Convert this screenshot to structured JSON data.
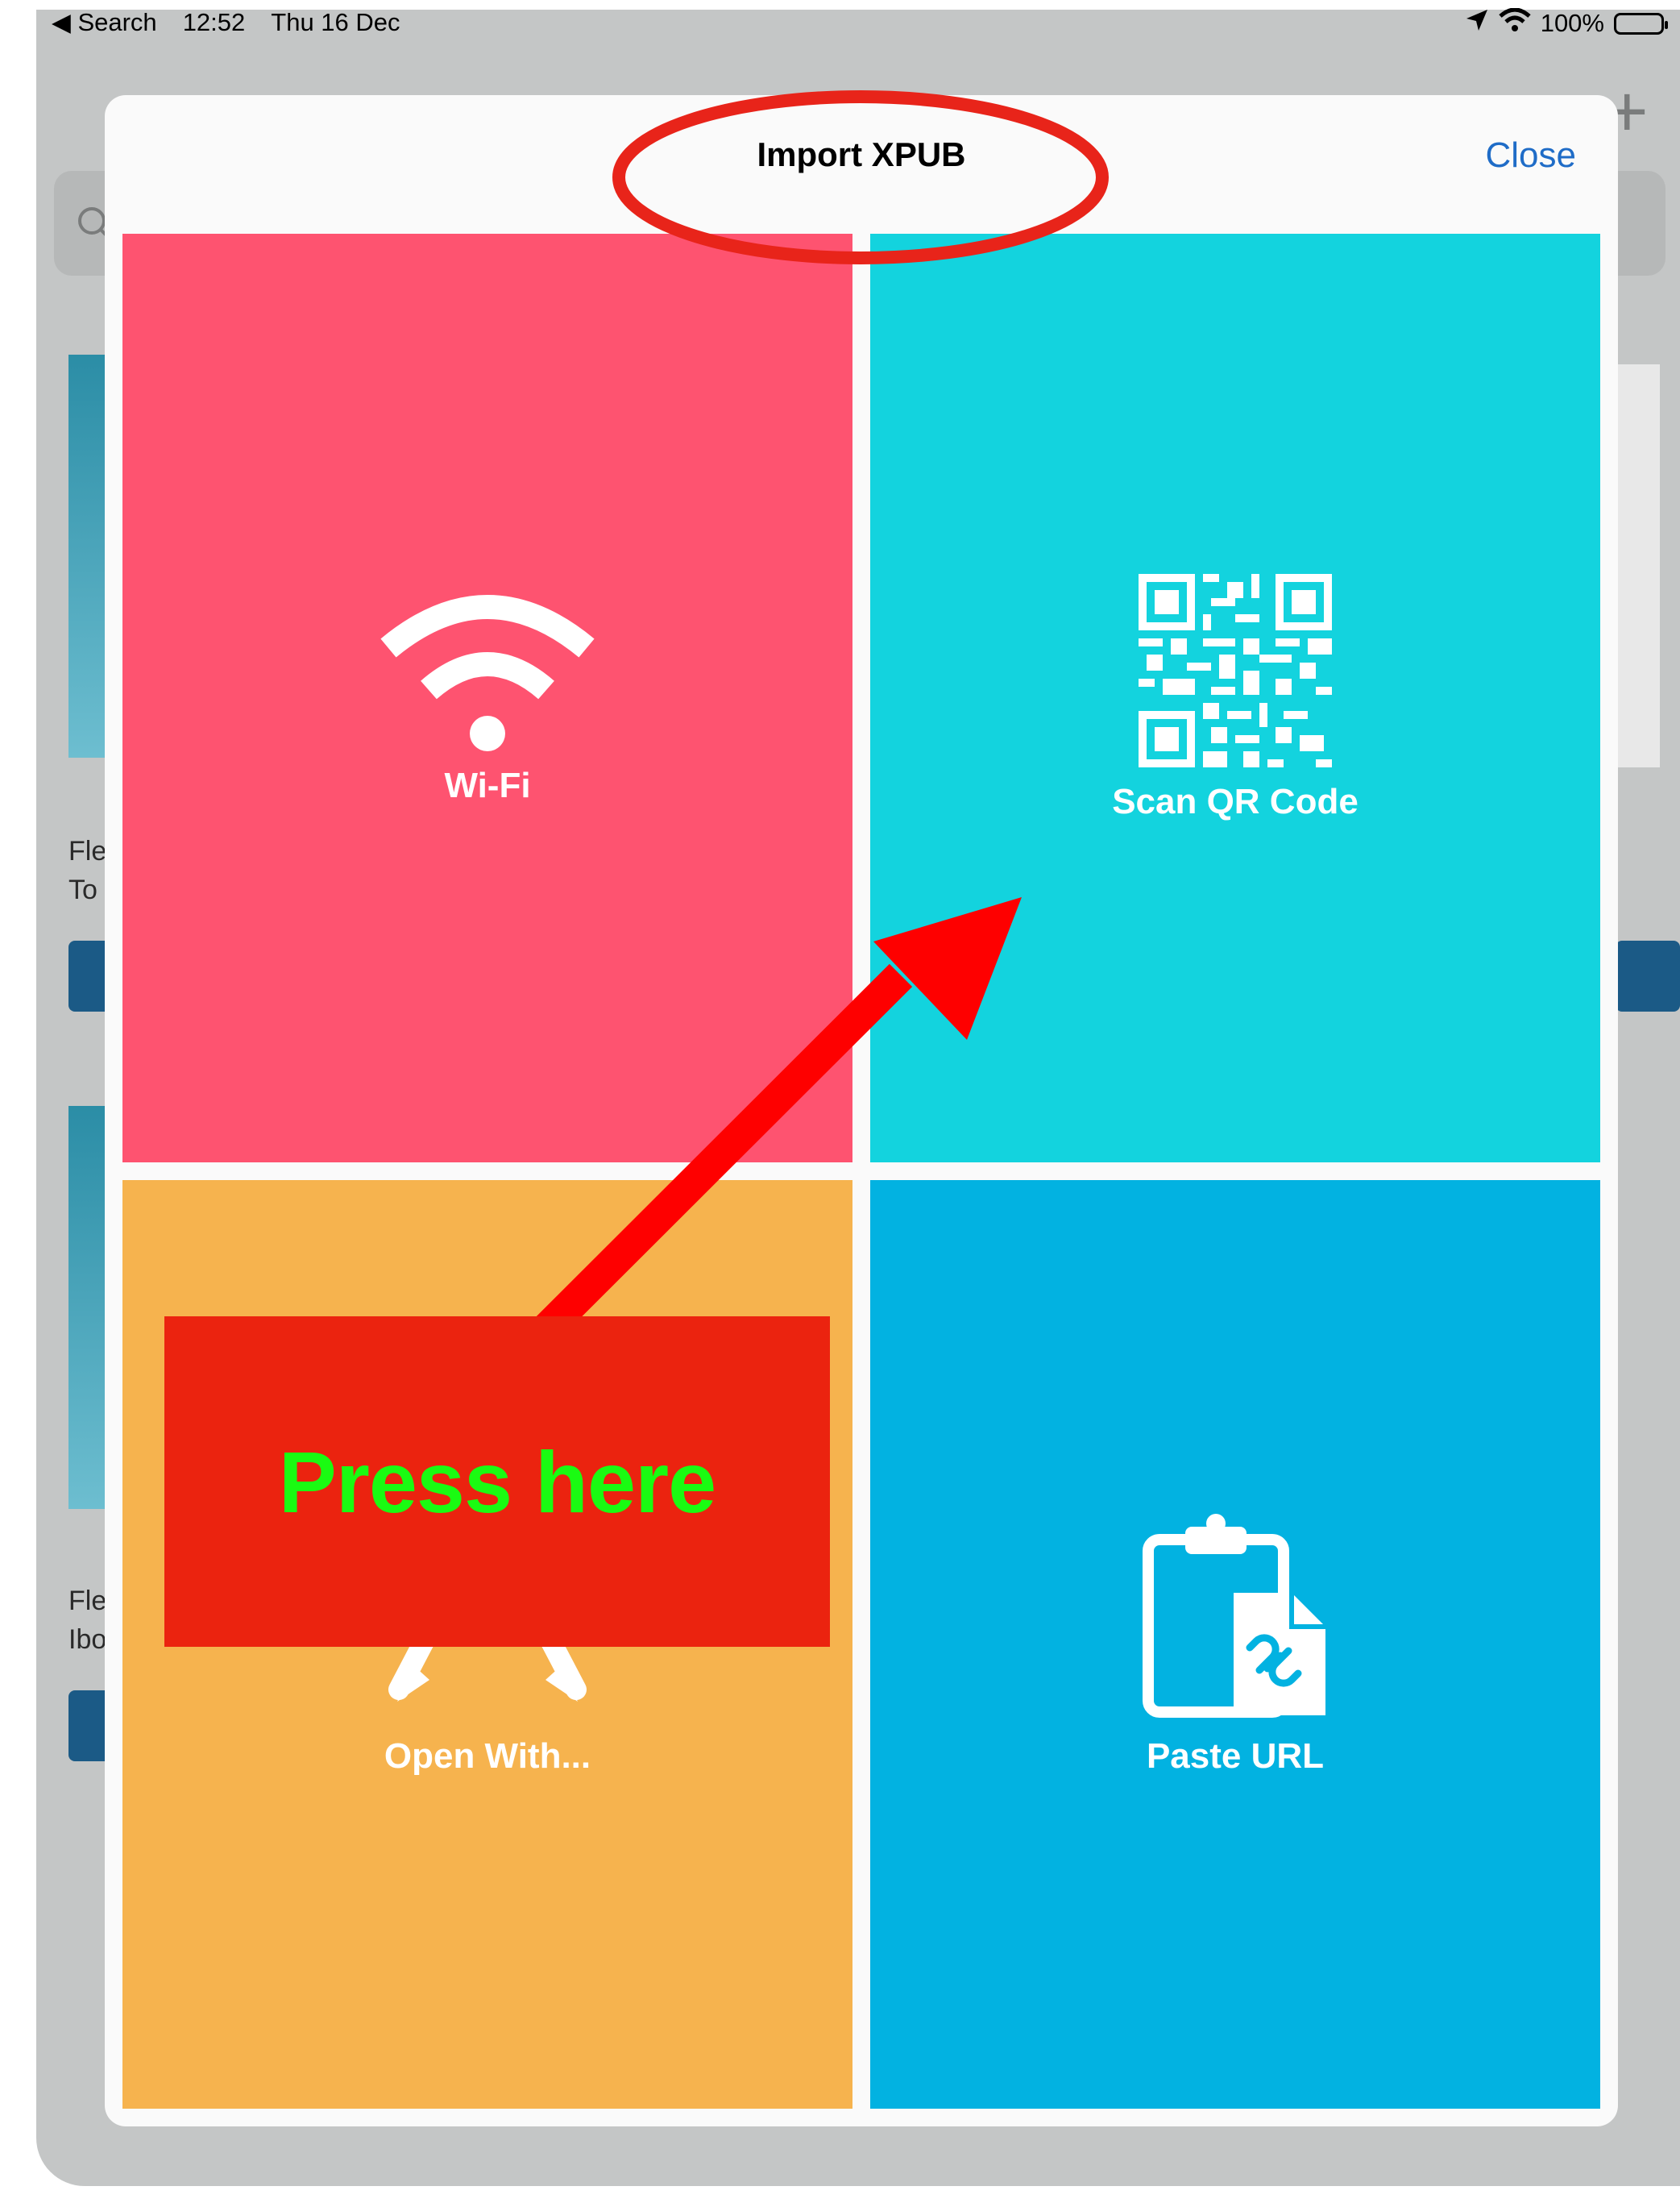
{
  "status_bar": {
    "back_app": "Search",
    "time": "12:52",
    "date": "Thu 16 Dec",
    "battery": "100%"
  },
  "background": {
    "item1_line1": "Fle",
    "item1_line2": "To",
    "item2_line1": "Fle",
    "item2_line2": "Ibo",
    "plus": "+"
  },
  "modal": {
    "title": "Import XPUB",
    "close_label": "Close",
    "options": {
      "wifi": "Wi-Fi",
      "qr": "Scan QR Code",
      "open_with": "Open With...",
      "paste_url": "Paste URL"
    }
  },
  "annotation": {
    "callout_text": "Press here",
    "arrow_color": "#fe0000",
    "circle_color": "#e8241a",
    "box_color": "#eb230f",
    "text_color": "#1afb12"
  },
  "colors": {
    "wifi_tile": "#fe5370",
    "qr_tile": "#13d3de",
    "open_tile": "#f6b34e",
    "paste_tile": "#02b2e1",
    "accent": "#1f6cc7"
  }
}
